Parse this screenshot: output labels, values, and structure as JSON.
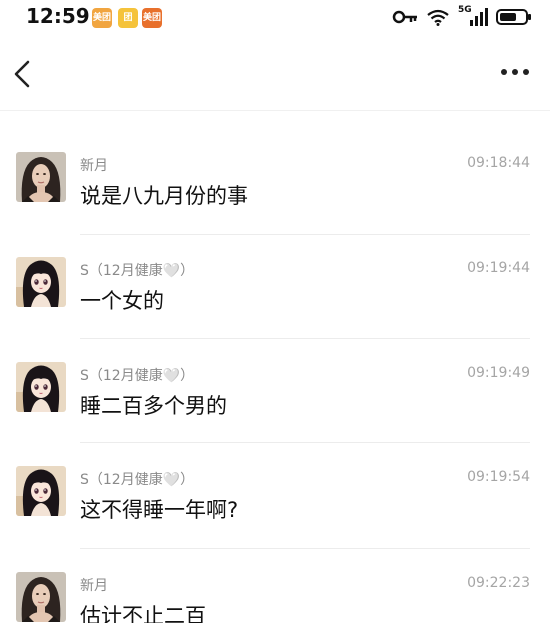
{
  "status_bar": {
    "time": "12:59",
    "badges": [
      "美团",
      "团",
      "美团"
    ],
    "network": "5G"
  },
  "header": {
    "back_icon": "chevron-left-icon",
    "more_icon": "ellipsis-icon"
  },
  "messages": [
    {
      "sender": "新月",
      "time": "09:18:44",
      "text": "说是八九月份的事",
      "avatar": "woman-portrait"
    },
    {
      "sender": "S（12月健康🤍）",
      "time": "09:19:44",
      "text": "一个女的",
      "avatar": "anime-girl"
    },
    {
      "sender": "S（12月健康🤍）",
      "time": "09:19:49",
      "text": "睡二百多个男的",
      "avatar": "anime-girl"
    },
    {
      "sender": "S（12月健康🤍）",
      "time": "09:19:54",
      "text": "这不得睡一年啊?",
      "avatar": "anime-girl"
    },
    {
      "sender": "新月",
      "time": "09:22:23",
      "text": "估计不止二百",
      "avatar": "woman-portrait"
    }
  ]
}
